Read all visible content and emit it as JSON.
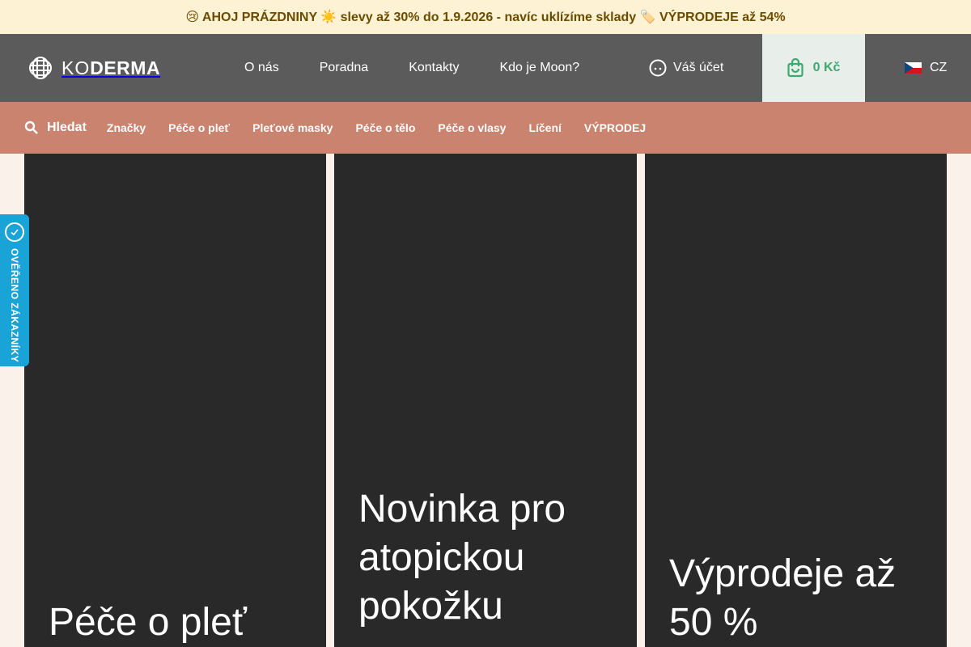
{
  "promo": {
    "text": "😢 AHOJ PRÁZDNINY ☀️ slevy až 30% do 1.9.2026 - navíc uklízíme sklady 🏷️ VÝPRODEJE až 54%"
  },
  "header": {
    "logo_text_thin": "KO",
    "logo_text_bold": "DERMA",
    "nav": [
      "O nás",
      "Poradna",
      "Kontakty",
      "Kdo je Moon?"
    ],
    "account_label": "Váš účet",
    "cart_total": "0 Kč",
    "language": "CZ"
  },
  "category_nav": {
    "search_label": "Hledat",
    "items": [
      "Značky",
      "Péče o pleť",
      "Pleťové masky",
      "Péče o tělo",
      "Péče o vlasy",
      "Líčení",
      "VÝPRODEJ"
    ]
  },
  "tiles": [
    {
      "title": "Péče o pleť"
    },
    {
      "title": "Novinka pro atopickou pokožku"
    },
    {
      "title": "Výprodeje až 50 %"
    }
  ],
  "trust_badge": {
    "label": "OVĚŘENO ZÁKAZNÍKY"
  },
  "colors": {
    "promo_bg": "#fdf3d4",
    "header_bg": "#5b5b5b",
    "category_bg": "#c9836f",
    "cart_bg": "#e8efeb",
    "cart_accent": "#3fa870",
    "tile_bg": "#292929",
    "badge_bg": "#1aa3d6"
  }
}
